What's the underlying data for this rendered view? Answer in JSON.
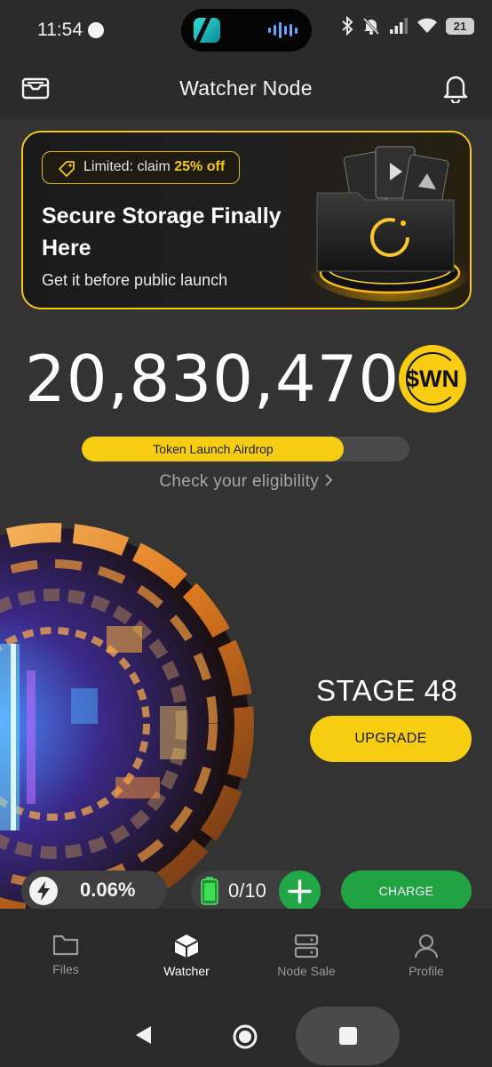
{
  "status_bar": {
    "time": "11:54",
    "battery": "21"
  },
  "header": {
    "title": "Watcher Node",
    "left_icon": "wallet-icon",
    "right_icon": "bell-icon"
  },
  "promo": {
    "pill_prefix": "Limited: claim ",
    "pill_highlight": "25% off",
    "title": "Secure Storage Finally Here",
    "subtitle": "Get it before public launch",
    "accent_color": "#f5c518"
  },
  "balance": {
    "amount": "20,830,470",
    "token": "$WN"
  },
  "airdrop": {
    "label": "Token Launch Airdrop",
    "progress_percent": 80,
    "link_text": "Check your eligibility"
  },
  "node": {
    "stage_label": "STAGE 48",
    "upgrade_label": "UPGRADE"
  },
  "stats": {
    "rate": "0.06%",
    "energy": "0/10",
    "charge_label": "CHARGE"
  },
  "tabs": [
    {
      "label": "Files",
      "icon": "folder-icon"
    },
    {
      "label": "Watcher",
      "icon": "cube-icon",
      "active": true
    },
    {
      "label": "Node Sale",
      "icon": "server-icon"
    },
    {
      "label": "Profile",
      "icon": "user-icon"
    }
  ],
  "colors": {
    "yellow": "#f7cd13",
    "green": "#21a243",
    "background": "#333333"
  }
}
